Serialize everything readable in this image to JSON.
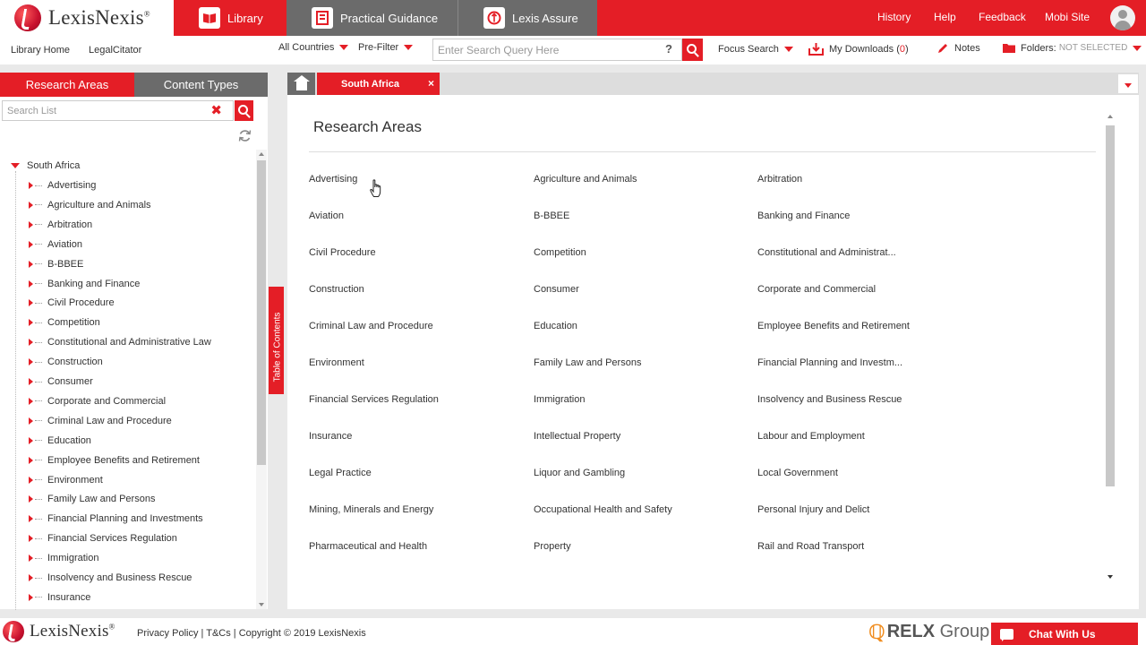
{
  "brand": {
    "name": "LexisNexis",
    "registered": "®",
    "accent": "#e41e26",
    "tab_inactive": "#6b6b6b"
  },
  "nav": {
    "tabs": [
      {
        "label": "Library",
        "icon": "book-icon"
      },
      {
        "label": "Practical Guidance",
        "icon": "document-icon"
      },
      {
        "label": "Lexis Assure",
        "icon": "shield-icon"
      }
    ],
    "right_links": [
      "History",
      "Help",
      "Feedback",
      "Mobi Site"
    ]
  },
  "subbar": {
    "library_home": "Library Home",
    "legal_citator": "LegalCitator",
    "countries": "All Countries",
    "prefilter": "Pre-Filter",
    "search_placeholder": "Enter Search Query Here",
    "help_mark": "?",
    "focus_search": "Focus Search",
    "downloads_label": "My Downloads",
    "downloads_count_open": "(",
    "downloads_count": "0",
    "downloads_count_close": ")",
    "notes": "Notes",
    "folders_label": "Folders:",
    "folders_value": "NOT SELECTED"
  },
  "left_panel": {
    "tabs": [
      "Research Areas",
      "Content Types"
    ],
    "search_placeholder": "Search List",
    "clear_mark": "✖",
    "root": "South Africa",
    "items": [
      "Advertising",
      "Agriculture and Animals",
      "Arbitration",
      "Aviation",
      "B-BBEE",
      "Banking and Finance",
      "Civil Procedure",
      "Competition",
      "Constitutional and Administrative Law",
      "Construction",
      "Consumer",
      "Corporate and Commercial",
      "Criminal Law and Procedure",
      "Education",
      "Employee Benefits and Retirement",
      "Environment",
      "Family Law and Persons",
      "Financial Planning and Investments",
      "Financial Services Regulation",
      "Immigration",
      "Insolvency and Business Rescue",
      "Insurance"
    ],
    "toc_label": "Table of Contents"
  },
  "main": {
    "tab_label": "South Africa",
    "tab_close": "×",
    "title": "Research Areas",
    "areas": [
      "Advertising",
      "Agriculture and Animals",
      "Arbitration",
      "Aviation",
      "B-BBEE",
      "Banking and Finance",
      "Civil Procedure",
      "Competition",
      "Constitutional and Administrat...",
      "Construction",
      "Consumer",
      "Corporate and Commercial",
      "Criminal Law and Procedure",
      "Education",
      "Employee Benefits and Retirement",
      "Environment",
      "Family Law and Persons",
      "Financial Planning and Investm...",
      "Financial Services Regulation",
      "Immigration",
      "Insolvency and Business Rescue",
      "Insurance",
      "Intellectual Property",
      "Labour and Employment",
      "Legal Practice",
      "Liquor and Gambling",
      "Local Government",
      "Mining, Minerals and Energy",
      "Occupational Health and Safety",
      "Personal Injury and Delict",
      "Pharmaceutical and Health",
      "Property",
      "Rail and Road Transport"
    ]
  },
  "footer": {
    "links": "Privacy Policy | T&Cs | Copyright © 2019 LexisNexis",
    "relx_brand": "RELX",
    "relx_group": "Group",
    "chat": "Chat With Us"
  }
}
